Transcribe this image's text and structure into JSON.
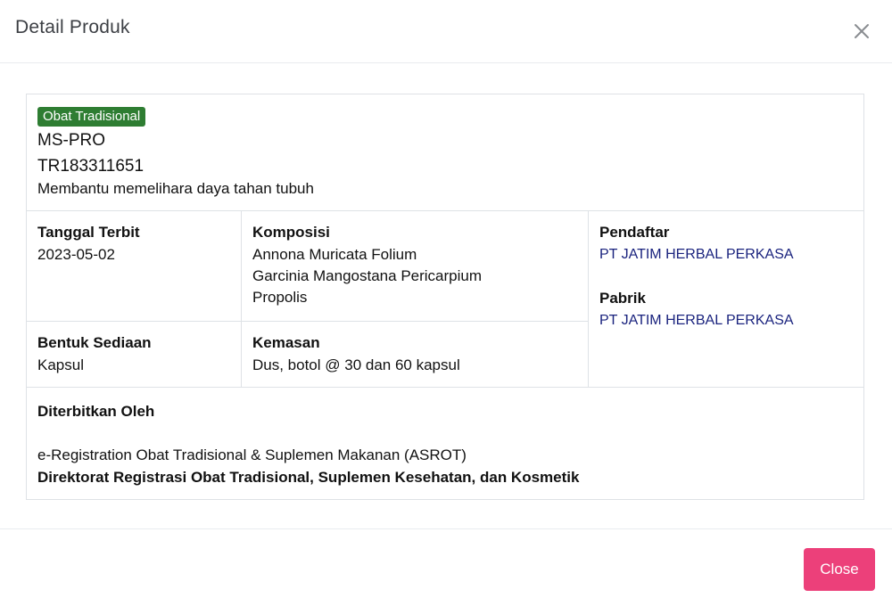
{
  "modal": {
    "title": "Detail Produk",
    "close_icon": "close-x-icon"
  },
  "product": {
    "category_badge": "Obat Tradisional",
    "name": "MS-PRO",
    "registration_number": "TR183311651",
    "claim": "Membantu memelihara daya tahan tubuh"
  },
  "details": {
    "issue_date": {
      "label": "Tanggal Terbit",
      "value": "2023-05-02"
    },
    "composition": {
      "label": "Komposisi",
      "items": [
        "Annona Muricata Folium",
        "Garcinia Mangostana Pericarpium",
        "Propolis"
      ]
    },
    "dosage_form": {
      "label": "Bentuk Sediaan",
      "value": "Kapsul"
    },
    "packaging": {
      "label": "Kemasan",
      "value": "Dus, botol @ 30 dan 60 kapsul"
    },
    "registrant": {
      "label": "Pendaftar",
      "value": "PT JATIM HERBAL PERKASA"
    },
    "manufacturer": {
      "label": "Pabrik",
      "value": "PT JATIM HERBAL PERKASA"
    },
    "issued_by": {
      "label": "Diterbitkan Oleh",
      "system": "e-Registration Obat Tradisional & Suplemen Makanan (ASROT)",
      "directorate": "Direktorat Registrasi Obat Tradisional, Suplemen Kesehatan, dan Kosmetik"
    }
  },
  "footer": {
    "close_label": "Close"
  },
  "colors": {
    "badge": "#2e7d32",
    "link": "#1a237e",
    "close_button": "#ec407a"
  }
}
